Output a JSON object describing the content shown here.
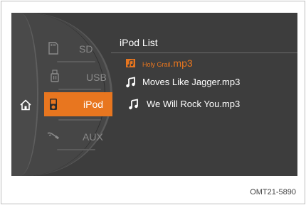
{
  "sources": [
    {
      "label": "SD",
      "icon": "sd-card-icon",
      "active": false
    },
    {
      "label": "USB",
      "icon": "usb-icon",
      "active": false
    },
    {
      "label": "iPod",
      "icon": "ipod-icon",
      "active": true
    },
    {
      "label": "AUX",
      "icon": "aux-cable-icon",
      "active": false
    }
  ],
  "home_icon": "home-icon",
  "list": {
    "title": "iPod List",
    "tracks": [
      {
        "name_prefix": "Holy Grail",
        "name_ext": ".mp3",
        "icon": "music-folder-icon",
        "highlighted": true
      },
      {
        "name": "Moves Like Jagger.mp3",
        "icon": "music-note-icon",
        "highlighted": false
      },
      {
        "name": "We Will Rock You.mp3",
        "icon": "music-note-icon",
        "highlighted": false
      }
    ]
  },
  "caption": "OMT21-5890",
  "colors": {
    "accent": "#e8761f",
    "screen_bg": "#3d3d3d",
    "inactive_text": "#8a8a8a"
  }
}
